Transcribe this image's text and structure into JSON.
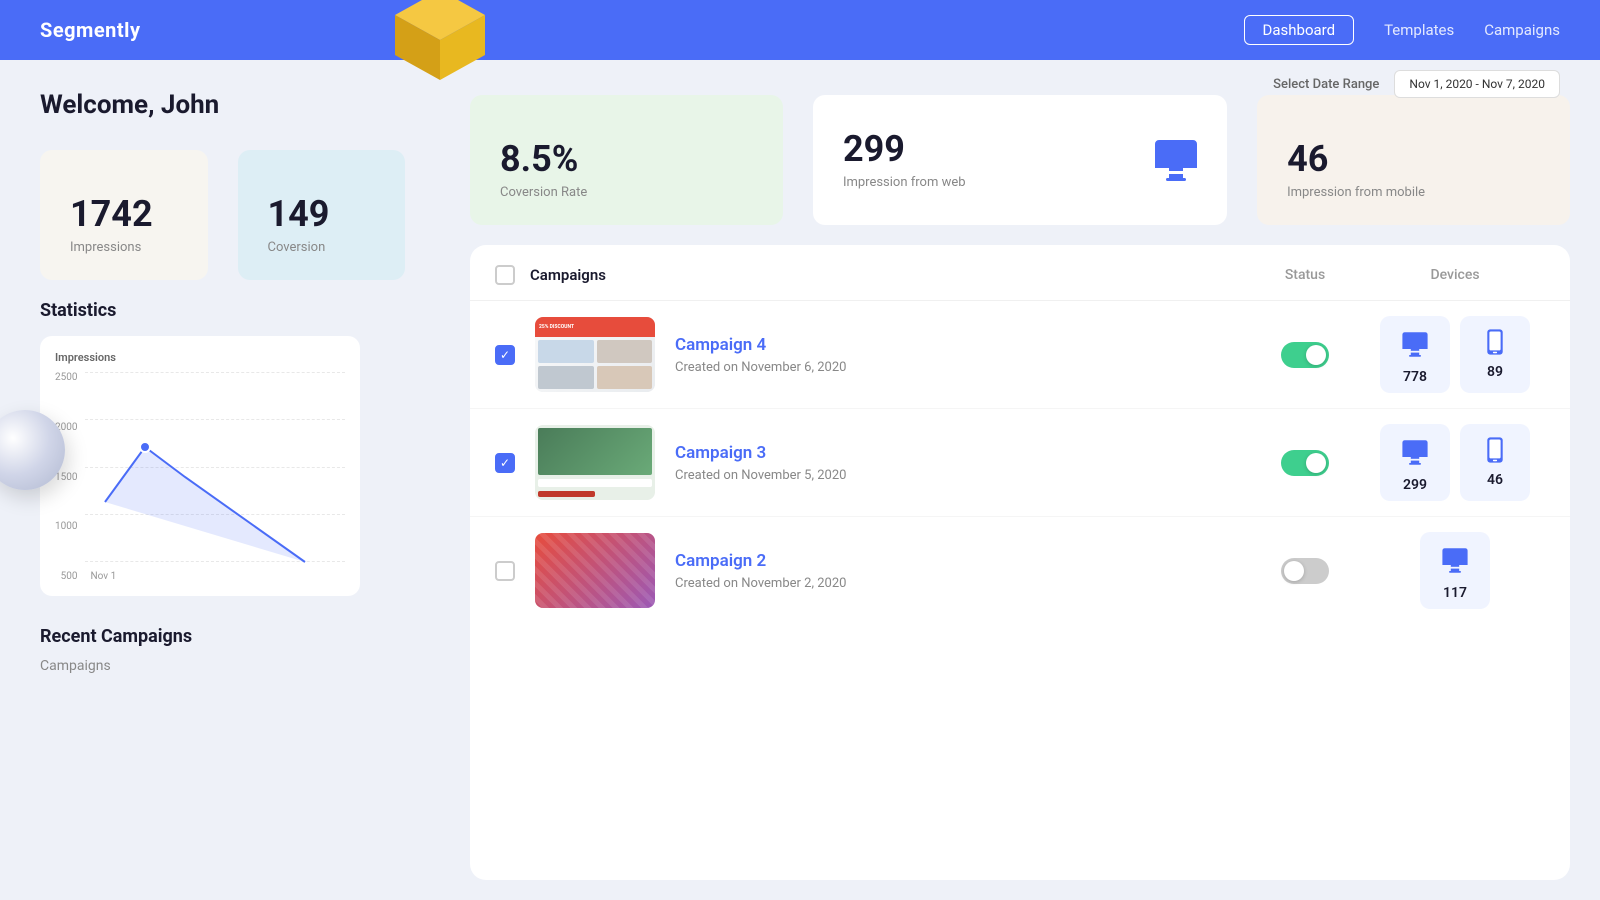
{
  "navbar": {
    "brand": "Segmently",
    "links": [
      {
        "label": "Dashboard",
        "active": true
      },
      {
        "label": "Templates",
        "active": false
      },
      {
        "label": "Campaigns",
        "active": false
      }
    ]
  },
  "header": {
    "welcome": "Welcome, John",
    "date_range_label": "Select Date Range",
    "date_range_value": "Nov 1, 2020 - Nov 7, 2020"
  },
  "stats": {
    "impressions": {
      "value": "1742",
      "label": "Impressions"
    },
    "conversion": {
      "value": "149",
      "label": "Coversion"
    },
    "conversion_rate": {
      "value": "8.5%",
      "label": "Coversion Rate"
    },
    "web": {
      "value": "299",
      "label": "Impression from web"
    },
    "mobile": {
      "value": "46",
      "label": "Impression from mobile"
    }
  },
  "chart": {
    "title": "Impressions",
    "y_labels": [
      "2500",
      "2000",
      "1500",
      "1000",
      "500"
    ],
    "x_label": "Nov 1"
  },
  "sidebar": {
    "statistics_title": "Statistics",
    "recent_title": "Recent Campaigns",
    "recent_sub": "Campaigns"
  },
  "campaigns_panel": {
    "header": {
      "title": "Campaigns",
      "col_status": "Status",
      "col_devices": "Devices"
    },
    "rows": [
      {
        "name": "Campaign 4",
        "date": "Created on November 6, 2020",
        "active": true,
        "checked": true,
        "web_count": "778",
        "mobile_count": "89"
      },
      {
        "name": "Campaign 3",
        "date": "Created on November 5, 2020",
        "active": true,
        "checked": true,
        "web_count": "299",
        "mobile_count": "46"
      },
      {
        "name": "Campaign 2",
        "date": "Created on November 2, 2020",
        "active": false,
        "checked": false,
        "web_count": "117",
        "mobile_count": null
      }
    ]
  }
}
